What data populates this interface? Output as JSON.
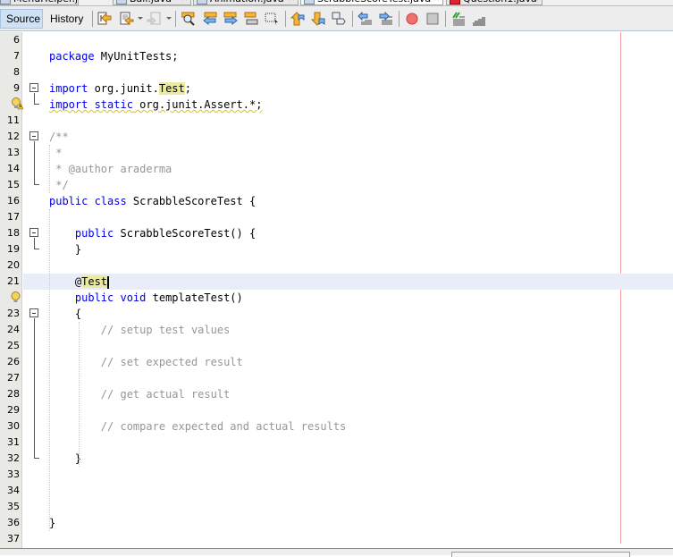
{
  "tabs": [
    {
      "label": "MenuHelper.java",
      "active": false,
      "icon": "java-file-icon"
    },
    {
      "label": "Ball.java",
      "active": false,
      "icon": "java-file-icon"
    },
    {
      "label": "Animation.java",
      "active": false,
      "icon": "java-file-icon"
    },
    {
      "label": "ScrabbleScoreTest.java",
      "active": true,
      "icon": "java-test-file-icon"
    },
    {
      "label": "Question1.java",
      "active": false,
      "icon": "java-file-error-icon"
    }
  ],
  "toolbar": {
    "source_label": "Source",
    "history_label": "History",
    "icons": [
      "last-edit-icon",
      "back-icon",
      "forward-icon",
      "find-icon",
      "find-previous-icon",
      "find-next-icon",
      "toggle-highlight-icon",
      "rectangular-selection-icon",
      "previous-bookmark-icon",
      "next-bookmark-icon",
      "toggle-bookmark-icon",
      "shift-left-icon",
      "shift-right-icon",
      "start-macro-icon",
      "stop-macro-icon",
      "comment-icon",
      "uncomment-icon"
    ]
  },
  "editor": {
    "lines": [
      {
        "n": "6",
        "parts": []
      },
      {
        "n": "7",
        "parts": [
          [
            "kw",
            "package"
          ],
          [
            "",
            " MyUnitTests;"
          ]
        ]
      },
      {
        "n": "8",
        "parts": []
      },
      {
        "n": "9",
        "parts": [
          [
            "kw",
            "import"
          ],
          [
            "",
            " org.junit."
          ],
          [
            "hl",
            "Test"
          ],
          [
            "",
            ";"
          ]
        ]
      },
      {
        "n": "",
        "parts": [
          [
            "kw-warn",
            "import static"
          ],
          [
            "warn",
            " org.junit.Assert.*;"
          ]
        ],
        "annotation": "warning-bulb"
      },
      {
        "n": "11",
        "parts": []
      },
      {
        "n": "12",
        "parts": [
          [
            "cm",
            "/**"
          ]
        ]
      },
      {
        "n": "13",
        "parts": [
          [
            "cm",
            " *"
          ]
        ]
      },
      {
        "n": "14",
        "parts": [
          [
            "cm",
            " * @author araderma"
          ]
        ]
      },
      {
        "n": "15",
        "parts": [
          [
            "cm",
            " */"
          ]
        ]
      },
      {
        "n": "16",
        "parts": [
          [
            "kw",
            "public class"
          ],
          [
            "",
            " ScrabbleScoreTest {"
          ]
        ]
      },
      {
        "n": "17",
        "parts": []
      },
      {
        "n": "18",
        "parts": [
          [
            "",
            "    "
          ],
          [
            "kw",
            "public"
          ],
          [
            "",
            " ScrabbleScoreTest() {"
          ]
        ]
      },
      {
        "n": "19",
        "parts": [
          [
            "",
            "    }"
          ]
        ]
      },
      {
        "n": "20",
        "parts": []
      },
      {
        "n": "21",
        "parts": [
          [
            "",
            "    @"
          ],
          [
            "hl",
            "Test"
          ]
        ],
        "current": true
      },
      {
        "n": "",
        "parts": [
          [
            "",
            "    "
          ],
          [
            "kw",
            "public void"
          ],
          [
            "",
            " templateTest()"
          ]
        ],
        "annotation": "hint-bulb"
      },
      {
        "n": "23",
        "parts": [
          [
            "",
            "    {"
          ]
        ]
      },
      {
        "n": "24",
        "parts": [
          [
            "cm",
            "        // setup test values"
          ]
        ]
      },
      {
        "n": "25",
        "parts": []
      },
      {
        "n": "26",
        "parts": [
          [
            "cm",
            "        // set expected result"
          ]
        ]
      },
      {
        "n": "27",
        "parts": []
      },
      {
        "n": "28",
        "parts": [
          [
            "cm",
            "        // get actual result"
          ]
        ]
      },
      {
        "n": "29",
        "parts": []
      },
      {
        "n": "30",
        "parts": [
          [
            "cm",
            "        // compare expected and actual results"
          ]
        ]
      },
      {
        "n": "31",
        "parts": []
      },
      {
        "n": "32",
        "parts": [
          [
            "",
            "    }"
          ]
        ]
      },
      {
        "n": "33",
        "parts": []
      },
      {
        "n": "34",
        "parts": []
      },
      {
        "n": "35",
        "parts": []
      },
      {
        "n": "36",
        "parts": [
          [
            "",
            "}"
          ]
        ]
      },
      {
        "n": "37",
        "parts": []
      }
    ]
  }
}
